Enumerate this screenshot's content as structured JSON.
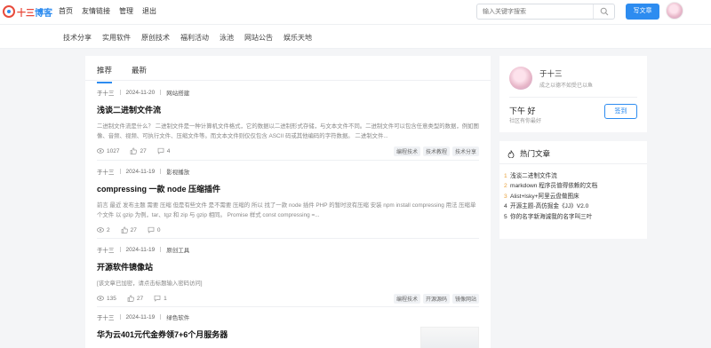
{
  "header": {
    "logo_text_a": "十三",
    "logo_text_b": "博客",
    "nav": [
      "首页",
      "友情链接",
      "管理",
      "退出"
    ],
    "search_placeholder": "输入关键字搜索",
    "write_button": "写文章"
  },
  "categories": [
    "技术分享",
    "实用软件",
    "原创技术",
    "福利活动",
    "泳池",
    "网站公告",
    "娱乐天地"
  ],
  "tabs": [
    "推荐",
    "最新"
  ],
  "posts": [
    {
      "author": "于十三",
      "date": "2024-11-20",
      "category": "网站搭建",
      "title": "浅谈二进制文件流",
      "excerpt": "二进制文件流是什么？ 二进制文件是一种计算机文件格式，它的数据以二进制形式存储，与文本文件不同。二进制文件可以包含任意类型的数据，例如图像、音频、视频、可执行文件、压缩文件等。而文本文件则仅仅包含 ASCII 码或其他编码的字符数据。 二进制文件...",
      "views": "1027",
      "likes": "27",
      "comments": "4",
      "tags": [
        "编程技术",
        "技术教程",
        "技术分享"
      ]
    },
    {
      "author": "于十三",
      "date": "2024-11-19",
      "category": "影视播放",
      "title": "compressing 一款 node 压缩插件",
      "excerpt": "前言 最近 发布主题 需要 压缩 但是有些文件 是不需要 压缩的 所以 找了一款 node 插件 PHP 的暂时没有压缩 安装 npm install compressing 用法 压缩单个文件 以 gzip 为例，tar、tgz 和 zip 与 gzip 相同。 Promise 样式 const compressing =...",
      "views": "2",
      "likes": "27",
      "comments": "0",
      "tags": []
    },
    {
      "author": "于十三",
      "date": "2024-11-19",
      "category": "原创工具",
      "title": "开源软件镜像站",
      "excerpt": "[该文章已加密，请点击标题输入密码访问]",
      "views": "135",
      "likes": "27",
      "comments": "1",
      "tags": [
        "编程技术",
        "开源源码",
        "镜像网站"
      ]
    },
    {
      "author": "于十三",
      "date": "2024-11-19",
      "category": "绿色软件",
      "title": "华为云401元代金券领7+6个月服务器",
      "excerpt": "",
      "views": "",
      "likes": "",
      "comments": "",
      "tags": []
    }
  ],
  "user": {
    "name": "于十三",
    "bio": "成之以德不如受已以鱼",
    "greeting": "下午 好",
    "subtitle": "社区有你最好",
    "signin": "签到"
  },
  "hot": {
    "title": "热门文章",
    "items": [
      {
        "n": "1",
        "t": "浅谈二进制文件流"
      },
      {
        "n": "2",
        "t": "markdown 程序员值得依赖的文档"
      },
      {
        "n": "3",
        "t": "Alist+lsky+阿里云盘做图床"
      },
      {
        "n": "4",
        "t": "开源主题-高仿掘金《JJ》V2.0"
      },
      {
        "n": "5",
        "t": "你的名字新海诚我的名字叫三叶"
      }
    ]
  },
  "colors": {
    "accent": "#2d8cf0",
    "logo": "#e84b3c",
    "rank": "#e8a13c"
  }
}
